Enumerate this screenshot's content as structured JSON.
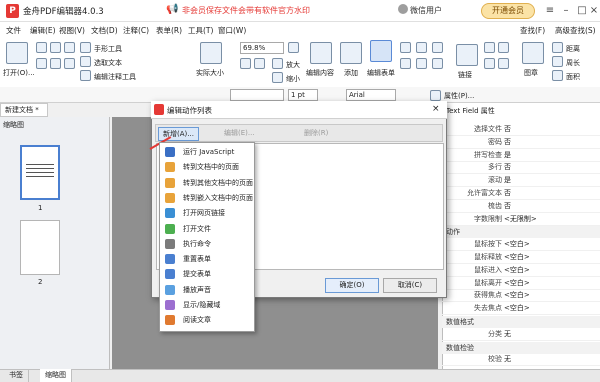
{
  "app": {
    "title": "金舟PDF编辑器4.0.3",
    "warning": "非会员保存文件会带有软件官方水印",
    "user": "微信用户",
    "vip_label": "开通会员"
  },
  "menu": [
    "文件",
    "编辑(E)",
    "视图(V)",
    "文档(D)",
    "注释(C)",
    "表单(R)",
    "工具(T)",
    "窗口(W)"
  ],
  "menu_right": [
    "查找(F)",
    "高级查找(S)"
  ],
  "ribbon": {
    "open": "打开(O)...",
    "hand_tool": "手形工具",
    "select_text": "选取文本",
    "edit_annot": "编辑注释工具",
    "actual_size": "实际大小",
    "zoom_value": "69.8%",
    "zoom_in": "放大",
    "zoom_out": "缩小",
    "edit_content": "编辑内容",
    "add": "添加",
    "edit_form": "编辑表单",
    "link": "链接",
    "image": "图章",
    "distance": "距离",
    "perimeter": "周长",
    "area": "面积",
    "font": "Arial",
    "line_width": "1 pt",
    "properties": "属性(P)..."
  },
  "tabs": {
    "doc": "新建文档 *",
    "close": "×"
  },
  "left_panel": {
    "title": "缩略图",
    "page1": "1",
    "page2": "2"
  },
  "bottom_tabs": [
    "书签",
    "缩略图"
  ],
  "dialog": {
    "title": "编辑动作列表",
    "new_btn": "新增(A)...",
    "edit_btn": "编辑(E)...",
    "delete_btn": "删除(R)",
    "ok": "确定(O)",
    "cancel": "取消(C)"
  },
  "dropdown": [
    {
      "label": "运行 JavaScript",
      "color": "#3a6fc4"
    },
    {
      "label": "转到文档中的页面",
      "color": "#e8a33a"
    },
    {
      "label": "转到其他文档中的页面",
      "color": "#e8a33a"
    },
    {
      "label": "转到嵌入文档中的页面",
      "color": "#e8a33a"
    },
    {
      "label": "打开网页链接",
      "color": "#3a8fd4"
    },
    {
      "label": "打开文件",
      "color": "#4caf50"
    },
    {
      "label": "执行命令",
      "color": "#7b7b7b"
    },
    {
      "label": "重置表单",
      "color": "#4a7fd0"
    },
    {
      "label": "提交表单",
      "color": "#4a7fd0"
    },
    {
      "label": "播放声音",
      "color": "#5aa0e0"
    },
    {
      "label": "显示/隐藏域",
      "color": "#9c6fd0"
    },
    {
      "label": "阅读文章",
      "color": "#e07a30"
    }
  ],
  "properties": {
    "title": "Text Field 属性",
    "rows": [
      {
        "label": "选择文件",
        "value": "否"
      },
      {
        "label": "密码",
        "value": "否"
      },
      {
        "label": "拼写检查",
        "value": "是"
      },
      {
        "label": "多行",
        "value": "否"
      },
      {
        "label": "滚动",
        "value": "是"
      },
      {
        "label": "允许富文本",
        "value": "否"
      },
      {
        "label": "梳齿",
        "value": "否"
      },
      {
        "label": "字数限制",
        "value": "<无限制>"
      }
    ],
    "action_group": "动作",
    "actions": [
      {
        "label": "鼠标按下",
        "value": "<空白>"
      },
      {
        "label": "鼠标释放",
        "value": "<空白>"
      },
      {
        "label": "鼠标进入",
        "value": "<空白>"
      },
      {
        "label": "鼠标离开",
        "value": "<空白>"
      },
      {
        "label": "获得焦点",
        "value": "<空白>"
      },
      {
        "label": "失去焦点",
        "value": "<空白>"
      }
    ],
    "format_group": "数值格式",
    "calc_group": "数值检验",
    "format_value": {
      "label": "分类",
      "value": "无"
    },
    "calc_value": {
      "label": "校验",
      "value": "无"
    }
  }
}
